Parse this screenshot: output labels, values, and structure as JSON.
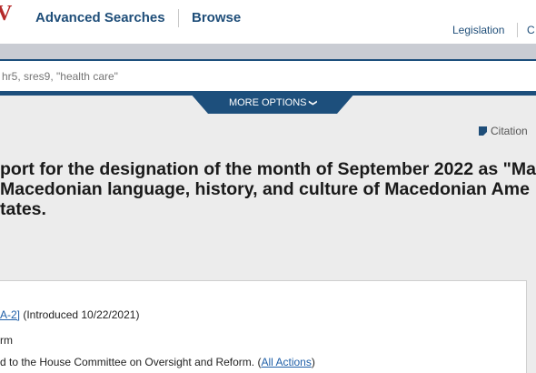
{
  "header": {
    "logo_fragment": "V",
    "nav": {
      "advanced_searches": "Advanced Searches",
      "browse": "Browse"
    },
    "sub_nav": {
      "legislation": "Legislation",
      "next": "C"
    }
  },
  "search": {
    "placeholder": "hr5, sres9, \"health care\""
  },
  "more_options": {
    "label": "MORE OPTIONS",
    "chevron": "❯"
  },
  "citation": {
    "label": "Citation"
  },
  "title": {
    "lines": [
      "port for the designation of the month of September 2022 as \"Ma",
      "Macedonian language, history, and culture of Macedonian Ame",
      "tates."
    ]
  },
  "panel": {
    "sponsor_link_fragment": "A-2]",
    "introduced": " (Introduced 10/22/2021)",
    "committee_fragment": "rm",
    "latest_action_text": "d to the House Committee on Oversight and Reform.  (",
    "all_actions_link": "All Actions",
    "latest_action_close": ")"
  },
  "colors": {
    "brand_red": "#b52a2a",
    "nav_blue": "#1f4e79",
    "bar_blue": "#1d4f7c",
    "link_blue": "#1f5fa8",
    "page_bg": "#ececec"
  }
}
